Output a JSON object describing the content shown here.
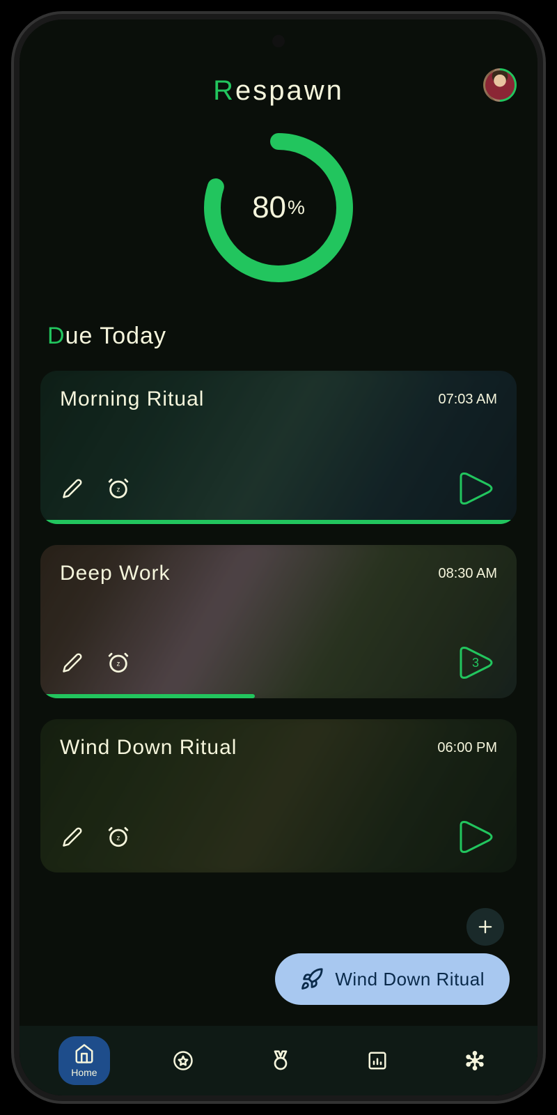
{
  "app": {
    "title_first": "R",
    "title_rest": "espawn"
  },
  "progress": {
    "value": 80,
    "display": "80",
    "suffix": "%"
  },
  "section": {
    "title_first": "D",
    "title_rest": "ue Today"
  },
  "cards": [
    {
      "title": "Morning Ritual",
      "time": "07:03 AM",
      "progress_pct": 100,
      "play_badge": ""
    },
    {
      "title": "Deep Work",
      "time": "08:30 AM",
      "progress_pct": 45,
      "play_badge": "3"
    },
    {
      "title": "Wind Down Ritual",
      "time": "06:00 PM",
      "progress_pct": 0,
      "play_badge": ""
    }
  ],
  "pill": {
    "label": "Wind Down Ritual"
  },
  "nav": {
    "items": [
      {
        "icon": "home",
        "label": "Home",
        "active": true
      },
      {
        "icon": "star",
        "label": "",
        "active": false
      },
      {
        "icon": "medal",
        "label": "",
        "active": false
      },
      {
        "icon": "chart",
        "label": "",
        "active": false
      },
      {
        "icon": "network",
        "label": "",
        "active": false
      }
    ]
  },
  "colors": {
    "accent": "#22c55e",
    "text": "#f5f5dc",
    "pill_bg": "#a8c8f0",
    "nav_active": "#1e4d8b"
  }
}
